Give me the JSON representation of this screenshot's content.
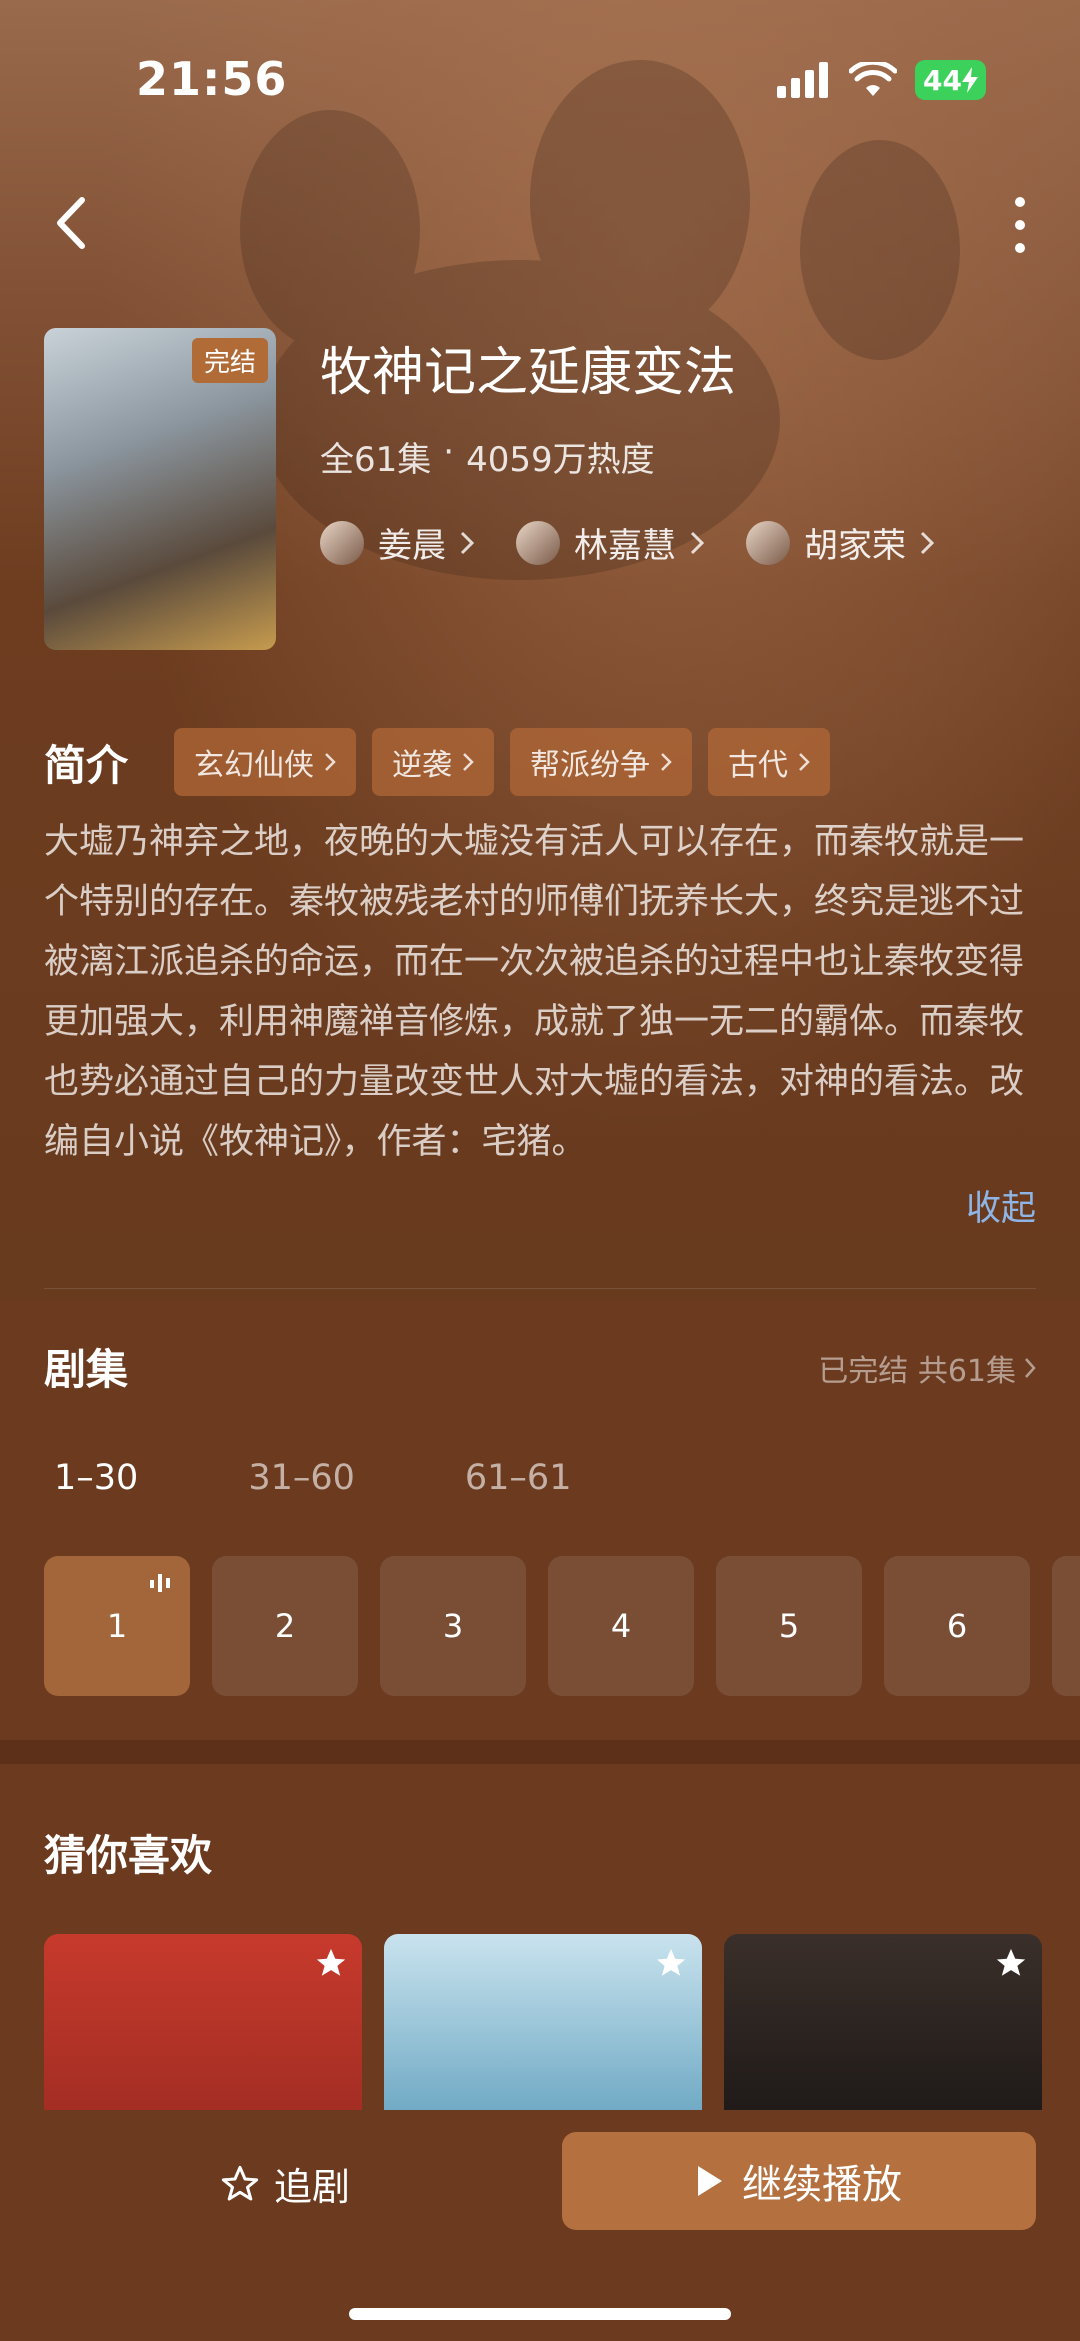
{
  "status_bar": {
    "time": "21:56",
    "battery": "44"
  },
  "drama": {
    "title": "牧神记之延康变法",
    "poster_badge": "完结",
    "episodes_total": "全61集",
    "separator": "·",
    "heat": "4059万热度",
    "cast": [
      {
        "name": "姜晨"
      },
      {
        "name": "林嘉慧"
      },
      {
        "name": "胡家荣"
      }
    ]
  },
  "intro": {
    "title": "简介",
    "tags": [
      {
        "label": "玄幻仙侠"
      },
      {
        "label": "逆袭"
      },
      {
        "label": "帮派纷争"
      },
      {
        "label": "古代"
      }
    ],
    "text": "大墟乃神弃之地，夜晚的大墟没有活人可以存在，而秦牧就是一个特别的存在。秦牧被残老村的师傅们抚养长大，终究是逃不过被漓江派追杀的命运，而在一次次被追杀的过程中也让秦牧变得更加强大，利用神魔禅音修炼，成就了独一无二的霸体。而秦牧也势必通过自己的力量改变世人对大墟的看法，对神的看法。改编自小说《牧神记》，作者：宅猪。",
    "collapse_label": "收起"
  },
  "episodes": {
    "title": "剧集",
    "status": "已完结 共61集",
    "ranges": [
      {
        "label": "1–30"
      },
      {
        "label": "31–60"
      },
      {
        "label": "61–61"
      }
    ],
    "items": [
      {
        "label": "1"
      },
      {
        "label": "2"
      },
      {
        "label": "3"
      },
      {
        "label": "4"
      },
      {
        "label": "5"
      },
      {
        "label": "6"
      }
    ]
  },
  "recommend": {
    "title": "猜你喜欢"
  },
  "bottom": {
    "follow_label": "追剧",
    "play_label": "继续播放"
  }
}
